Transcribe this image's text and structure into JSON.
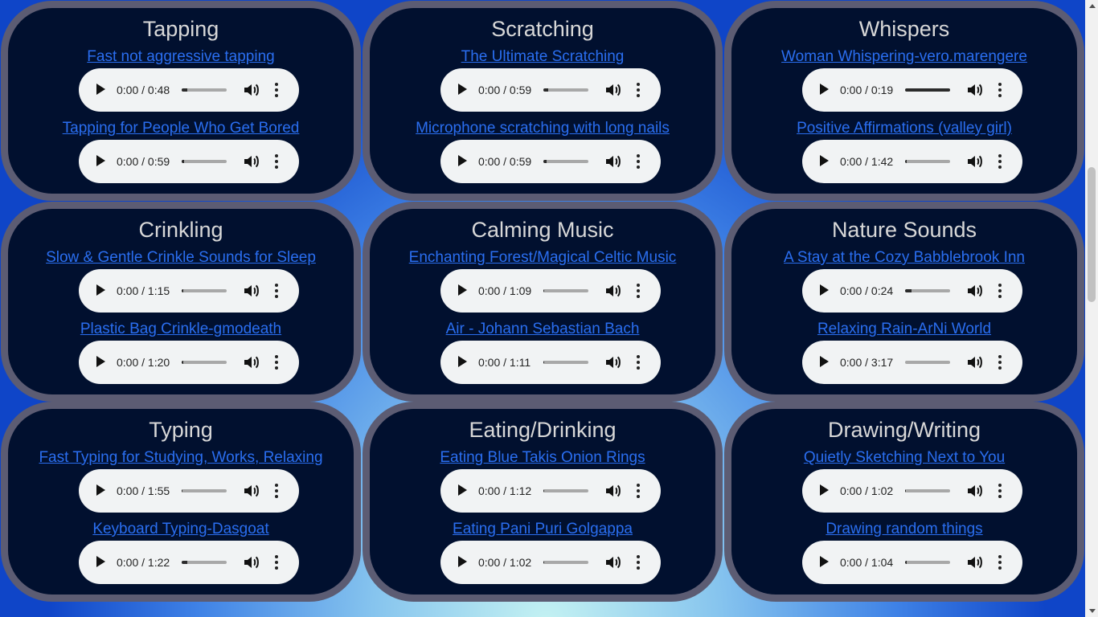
{
  "categories": [
    {
      "title": "Tapping",
      "tracks": [
        {
          "label": "Fast not aggressive tapping",
          "time": "0:00 / 0:48",
          "buffered": 0.12
        },
        {
          "label": "Tapping for People Who Get Bored",
          "time": "0:00 / 0:59",
          "buffered": 0.05
        }
      ]
    },
    {
      "title": "Scratching",
      "tracks": [
        {
          "label": "The Ultimate Scratching",
          "time": "0:00 / 0:59",
          "buffered": 0.1
        },
        {
          "label": "Microphone scratching with long nails",
          "time": "0:00 / 0:59",
          "buffered": 0.07
        }
      ]
    },
    {
      "title": "Whispers",
      "tracks": [
        {
          "label": "Woman Whispering-vero.marengere",
          "time": "0:00 / 0:19",
          "buffered": 1.0
        },
        {
          "label": "Positive Affirmations (valley girl)",
          "time": "0:00 / 1:42",
          "buffered": 0.04
        }
      ]
    },
    {
      "title": "Crinkling",
      "tracks": [
        {
          "label": "Slow & Gentle Crinkle Sounds for Sleep",
          "time": "0:00 / 1:15",
          "buffered": 0.04
        },
        {
          "label": "Plastic Bag Crinkle-gmodeath",
          "time": "0:00 / 1:20",
          "buffered": 0.04
        }
      ]
    },
    {
      "title": "Calming Music",
      "tracks": [
        {
          "label": "Enchanting Forest/Magical Celtic Music",
          "time": "0:00 / 1:09",
          "buffered": 0.02
        },
        {
          "label": "Air - Johann Sebastian Bach",
          "time": "0:00 / 1:11",
          "buffered": 0.02
        }
      ]
    },
    {
      "title": "Nature Sounds",
      "tracks": [
        {
          "label": "A Stay at the Cozy Babblebrook Inn",
          "time": "0:00 / 0:24",
          "buffered": 0.15
        },
        {
          "label": "Relaxing Rain-ArNi World",
          "time": "0:00 / 3:17",
          "buffered": 0.0
        }
      ]
    },
    {
      "title": "Typing",
      "tracks": [
        {
          "label": "Fast Typing for Studying, Works, Relaxing",
          "time": "0:00 / 1:55",
          "buffered": 0.02
        },
        {
          "label": "Keyboard Typing-Dasgoat",
          "time": "0:00 / 1:22",
          "buffered": 0.12
        }
      ]
    },
    {
      "title": "Eating/Drinking",
      "tracks": [
        {
          "label": "Eating Blue Takis Onion Rings",
          "time": "0:00 / 1:12",
          "buffered": 0.02
        },
        {
          "label": "Eating Pani Puri Golgappa",
          "time": "0:00 / 1:02",
          "buffered": 0.02
        }
      ]
    },
    {
      "title": "Drawing/Writing",
      "tracks": [
        {
          "label": "Quietly Sketching Next to You",
          "time": "0:00 / 1:02",
          "buffered": 0.02
        },
        {
          "label": "Drawing random things",
          "time": "0:00 / 1:04",
          "buffered": 0.04
        }
      ]
    }
  ],
  "colors": {
    "card": "#01102f",
    "card_border": "#5c5c73",
    "link": "#2a6ef0",
    "title": "#d8d8d8",
    "player_bg": "#f1f3f4"
  },
  "icons": {
    "play": "play-icon",
    "volume": "volume-icon",
    "more": "more-options-icon"
  }
}
